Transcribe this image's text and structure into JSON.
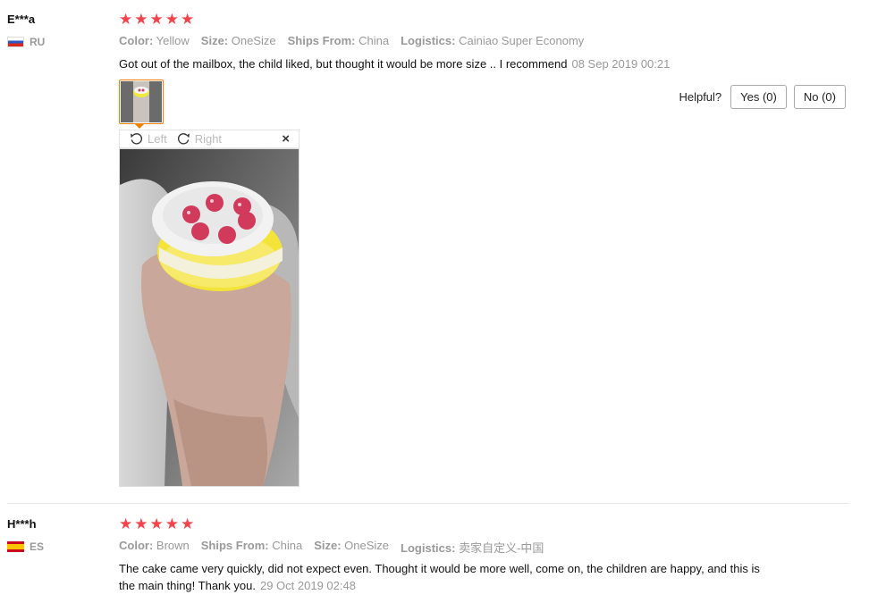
{
  "reviews": [
    {
      "user": "E***a",
      "country": "RU",
      "stars": 5,
      "props": [
        {
          "key": "Color:",
          "value": "Yellow"
        },
        {
          "key": "Size:",
          "value": "OneSize"
        },
        {
          "key": "Ships From:",
          "value": "China"
        },
        {
          "key": "Logistics:",
          "value": "Cainiao Super Economy"
        }
      ],
      "text": "Got out of the mailbox, the child liked, but thought it would be more size .. I recommend",
      "date": "08 Sep 2019 00:21"
    },
    {
      "user": "H***h",
      "country": "ES",
      "stars": 5,
      "props": [
        {
          "key": "Color:",
          "value": "Brown"
        },
        {
          "key": "Ships From:",
          "value": "China"
        },
        {
          "key": "Size:",
          "value": "OneSize"
        },
        {
          "key": "Logistics:",
          "value": "卖家自定义-中国"
        }
      ],
      "text": "The cake came very quickly, did not expect even. Thought it would be more well, come on, the children are happy, and this is the main thing! Thank you.",
      "date": "29 Oct 2019 02:48"
    }
  ],
  "viewer": {
    "left_label": "Left",
    "right_label": "Right",
    "close_label": "×"
  },
  "helpful": {
    "label": "Helpful?",
    "yes": "Yes (0)",
    "no": "No (0)"
  },
  "colors": {
    "star": "#f5434c",
    "thumb_border": "#f08000",
    "muted": "#999999"
  }
}
